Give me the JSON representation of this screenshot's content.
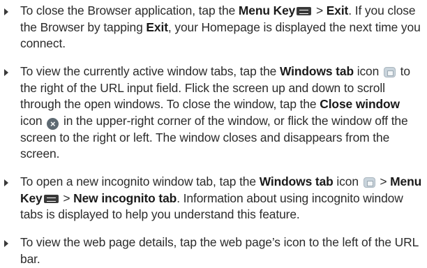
{
  "bullets": [
    {
      "parts": [
        {
          "t": "To close the Browser application, tap the "
        },
        {
          "b": "Menu Key"
        },
        {
          "icon": "menu-key-icon"
        },
        {
          "t": " > "
        },
        {
          "b": "Exit"
        },
        {
          "t": ". If you close the Browser by tapping "
        },
        {
          "b": "Exit"
        },
        {
          "t": ", your Homepage is displayed the next time you connect."
        }
      ]
    },
    {
      "parts": [
        {
          "t": "To view the currently active window tabs, tap the "
        },
        {
          "b": "Windows tab"
        },
        {
          "t": " icon "
        },
        {
          "icon": "windows-tab-icon"
        },
        {
          "t": " to the right of the URL input field. Flick the screen up and down to scroll through the open windows. To close the window, tap the "
        },
        {
          "b": "Close window"
        },
        {
          "t": " icon "
        },
        {
          "icon": "close-window-icon"
        },
        {
          "t": " in the upper-right corner of the window, or flick the window off the screen to the right or left. The window closes and disappears from the screen."
        }
      ]
    },
    {
      "parts": [
        {
          "t": "To open a new incognito window tab, tap the "
        },
        {
          "b": "Windows tab"
        },
        {
          "t": " icon "
        },
        {
          "icon": "windows-tab-icon"
        },
        {
          "t": " > "
        },
        {
          "b": "Menu Key"
        },
        {
          "icon": "menu-key-icon"
        },
        {
          "t": " > "
        },
        {
          "b": "New incognito tab"
        },
        {
          "t": ". Information about using incognito window tabs is displayed to help you understand this feature."
        }
      ]
    },
    {
      "parts": [
        {
          "t": "To view the web page details, tap the web page’s icon to the left of the URL bar."
        }
      ]
    }
  ]
}
